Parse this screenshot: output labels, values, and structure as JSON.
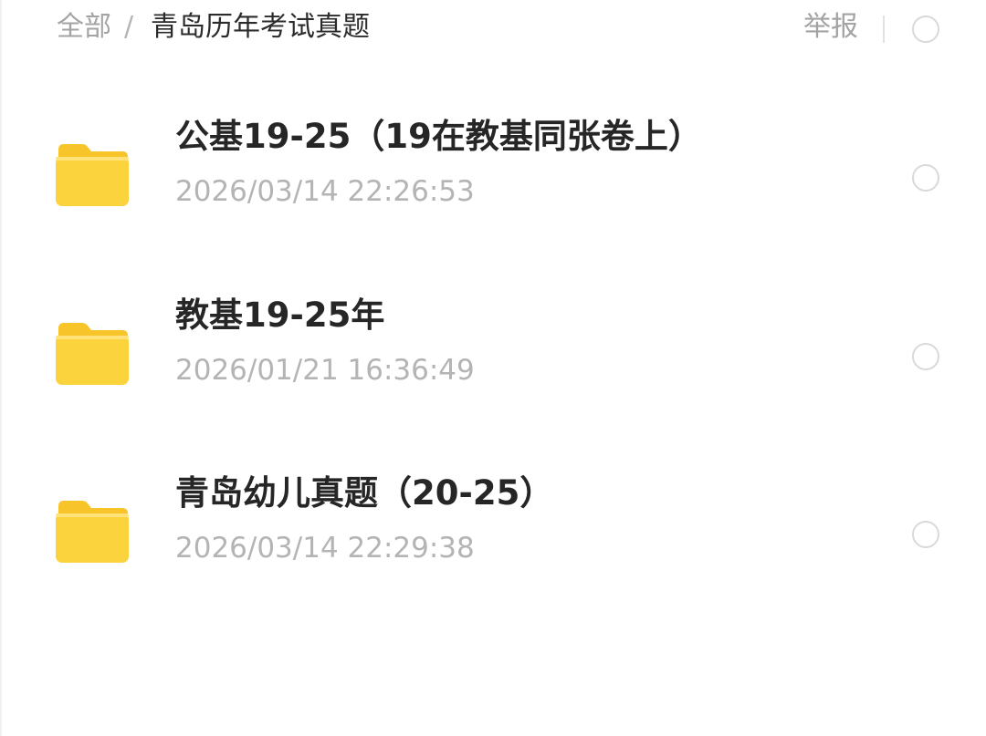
{
  "breadcrumb": {
    "root": "全部",
    "separator": "/",
    "current": "青岛历年考试真题"
  },
  "header": {
    "report_label": "举报"
  },
  "files": [
    {
      "name": "公基19-25（19在教基同张卷上）",
      "date": "2026/03/14 22:26:53",
      "icon": "folder-icon"
    },
    {
      "name": "教基19-25年",
      "date": "2026/01/21 16:36:49",
      "icon": "folder-icon"
    },
    {
      "name": "青岛幼儿真题（20-25）",
      "date": "2026/03/14 22:29:38",
      "icon": "folder-icon"
    }
  ],
  "colors": {
    "folder_body": "#fbd33c",
    "folder_tab": "#f7c52a",
    "muted_text": "#a3a3a3",
    "title_text": "#262626"
  }
}
